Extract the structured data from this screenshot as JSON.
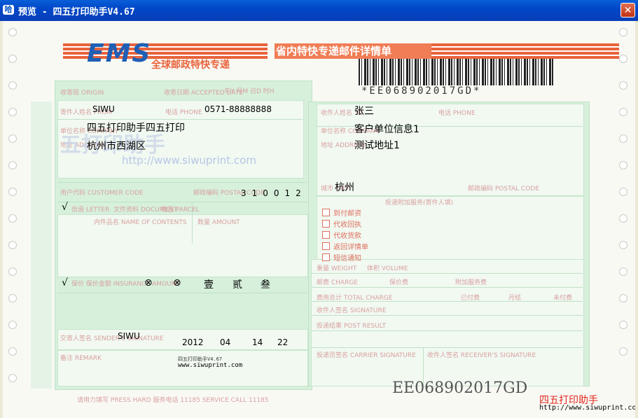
{
  "window": {
    "title": "预览 - 四五打印助手V4.67",
    "icon_text": "哈",
    "close_symbol": "✕"
  },
  "form": {
    "ems_logo": "EMS",
    "ems_slogan": "全球邮政特快专递",
    "heading": "省内特快专递邮件详情单",
    "barcode_text": "*EE068902017GD*",
    "tracking_number": "EE068902017GD",
    "watermark_text": "五打印助手",
    "watermark_url": "http://www.siwuprint.com",
    "labels": {
      "origin": "收寄局 ORIGIN",
      "accepted_date": "收寄日期 ACCEPTED DATE",
      "ymd": "年Y  月M  日D  时H",
      "sender_name": "寄件人姓名 FROM",
      "sender_phone": "电话 PHONE",
      "company": "单位名称 COMPANY",
      "address": "地址 ADDRESS",
      "customer_code": "用户代码 CUSTOMER CODE",
      "postal_code": "邮政编码 POSTAL CODE",
      "letter": "信函 LETTER",
      "document": "文件资料 DOCUMENT",
      "parcel": "物品 PARCEL",
      "contents": "内件品名 NAME OF CONTENTS",
      "amount": "数量 AMOUNT",
      "insurance": "保价 保价金额 INSURANCE AMOUNT",
      "sender_signature": "交寄人签名 SENDER'S SIGNATURE",
      "remark": "备注 REMARK",
      "receiver_name": "收件人姓名 TO",
      "receiver_phone": "电话 PHONE",
      "receiver_company": "单位名称 COMPANY",
      "receiver_address": "地址 ADDRESS",
      "city": "城市 CITY",
      "receiver_postal": "邮政编码 POSTAL CODE",
      "delivery_service": "投递附加服务(寄件人填)",
      "paid_to_arrive": "到付邮资",
      "cod_return": "代收回执",
      "cod_payment": "代收货款",
      "arrive_note": "返回详情单",
      "short_msg": "短信通知",
      "weight": "重量 WEIGHT",
      "volume": "体积 VOLUME",
      "postage": "邮费 CHARGE",
      "insurance_fee": "保价费",
      "additional_charge": "附加服务费",
      "total": "费用总计 TOTAL CHARGE",
      "paid": "已付费",
      "monthly": "月结",
      "unpaid": "未付费",
      "receiver_signature": "收件人签名 SIGNATURE",
      "delivery_result": "投递结果 POST RESULT",
      "carrier_signature": "投递员签名 CARRIER SIGNATURE",
      "receiver_sign2": "收件人签名 RECEIVER'S SIGNATURE",
      "footer_note": "请用力填写 PRESS HARD   服务电话 11185   SERVICE CALL 11185"
    },
    "values": {
      "sender_name": "SIWU",
      "sender_phone": "0571-88888888",
      "sender_company": "四五打印助手四五打印",
      "sender_address": "杭州市西湖区",
      "sender_postal_code": "310012",
      "letter_check": "√",
      "insurance_check": "√",
      "amount_cn_1": "⊗",
      "amount_cn_2": "⊗",
      "amount_cn_3": "壹",
      "amount_cn_4": "贰",
      "amount_cn_5": "叁",
      "signature": "SIWU",
      "year": "2012",
      "month": "04",
      "day": "14",
      "hour": "22",
      "receiver_name": "张三",
      "receiver_company": "客户单位信息1",
      "receiver_address": "测试地址1",
      "receiver_city": "杭州",
      "print_brand_small": "四五打印助手V4.67",
      "print_url_small": "www.siwuprint.com"
    }
  },
  "brand": {
    "name": "四五打印助手",
    "url": "http://www.siwuprint.com"
  }
}
